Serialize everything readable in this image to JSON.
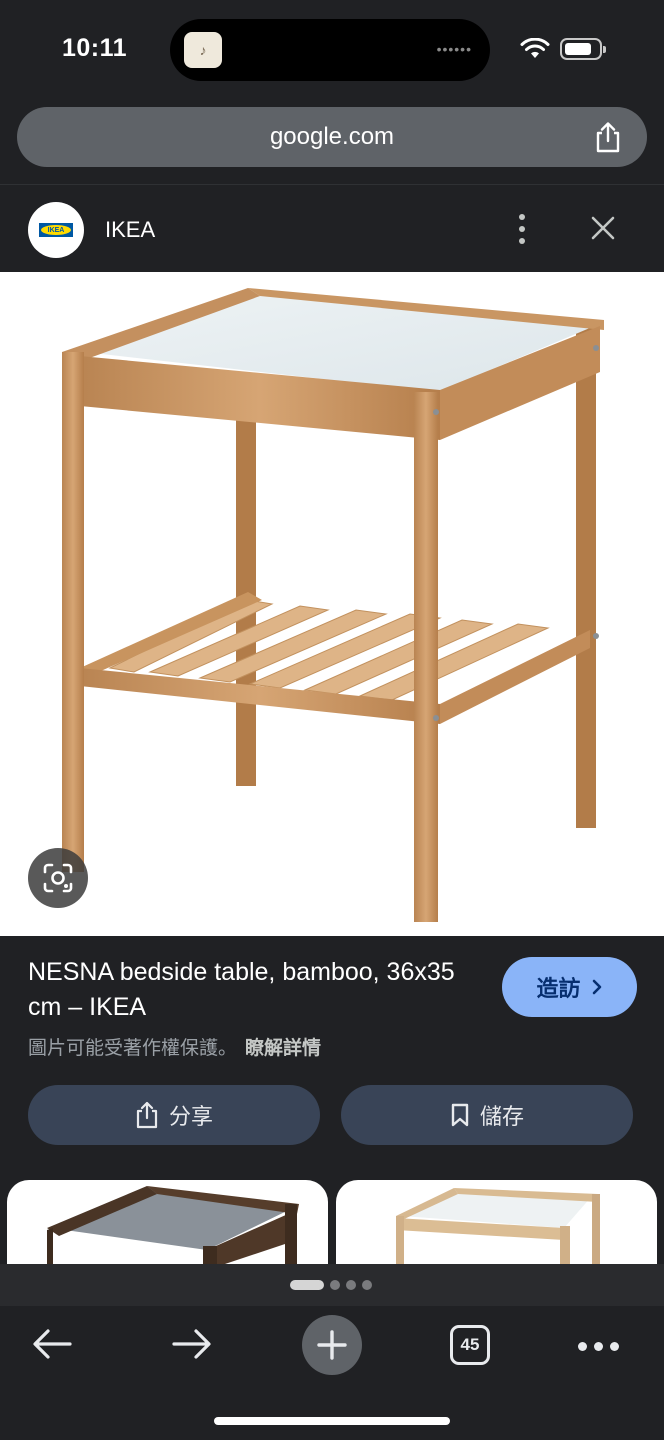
{
  "status_bar": {
    "time": "10:11",
    "island_dots": "••••••"
  },
  "browser": {
    "url": "google.com"
  },
  "site": {
    "name": "IKEA",
    "logo_text": "IKEA"
  },
  "result": {
    "title": "NESNA bedside table, bamboo, 36x35 cm – IKEA",
    "visit_label": "造訪",
    "copyright_notice": "圖片可能受著作權保護。",
    "learn_more": "瞭解詳情",
    "share_label": "分享",
    "save_label": "儲存"
  },
  "pagination": {
    "page_count": 4,
    "current_page": 1
  },
  "toolbar": {
    "tab_count": "45"
  },
  "icons": {
    "share": "share-icon",
    "more": "more-vert-icon",
    "close": "close-icon",
    "lens": "lens-icon",
    "visit": "chevron-right-icon",
    "bookmark": "bookmark-icon",
    "back": "arrow-back-icon",
    "forward": "arrow-forward-icon",
    "new_tab": "plus-icon",
    "tabs": "tab-switcher-icon",
    "menu": "more-horiz-icon"
  },
  "colors": {
    "accent": "#8ab4f8",
    "chip": "#394457",
    "background": "#202124"
  }
}
